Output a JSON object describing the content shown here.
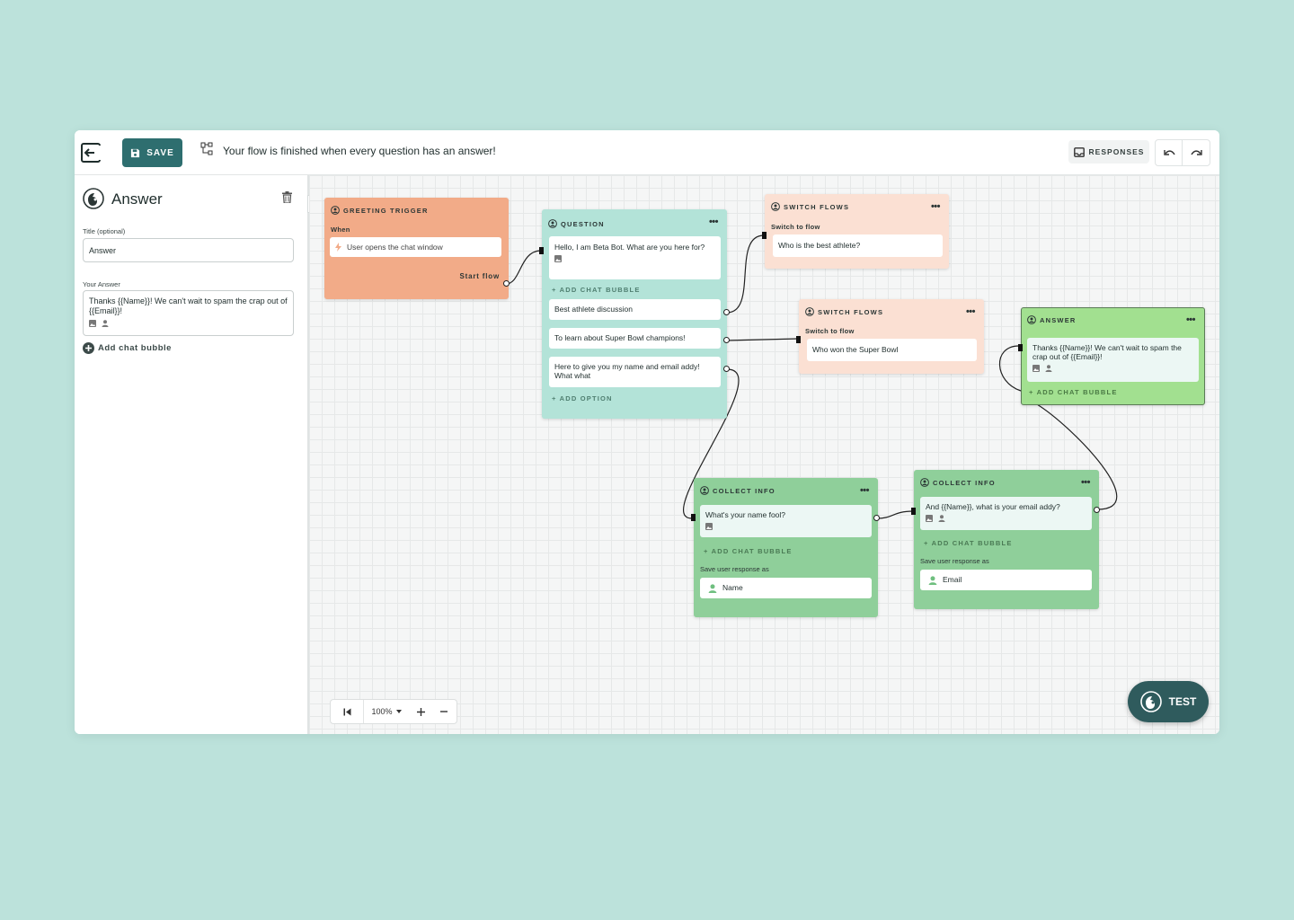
{
  "header": {
    "save_label": "SAVE",
    "status_text": "Your flow is finished when every question has an answer!",
    "responses_label": "RESPONSES"
  },
  "sidebar": {
    "title": "Answer",
    "title_field_label": "Title (optional)",
    "title_field_value": "Answer",
    "answer_field_label": "Your Answer",
    "answer_field_value": "Thanks {{Name}}! We can't wait to spam the crap out of {{Email}}!",
    "add_bubble_label": "Add chat bubble"
  },
  "nodes": {
    "greeting": {
      "header": "GREETING TRIGGER",
      "when_label": "When",
      "trigger_text": "User opens the chat window",
      "start_label": "Start flow",
      "color": "#f2ab88"
    },
    "question": {
      "header": "QUESTION",
      "menu": "•••",
      "message": "Hello, I am Beta Bot. What are you here for?",
      "add_bubble": "+ ADD CHAT BUBBLE",
      "options": [
        "Best athlete discussion",
        "To learn about Super Bowl champions!",
        "Here to give you my name and email addy! What what"
      ],
      "add_option": "+ ADD OPTION",
      "color": "#b3e3d8"
    },
    "switch1": {
      "header": "SWITCH FLOWS",
      "menu": "•••",
      "sub": "Switch to flow",
      "flow": "Who is the best athlete?",
      "color": "#fbe0d3"
    },
    "switch2": {
      "header": "SWITCH FLOWS",
      "menu": "•••",
      "sub": "Switch to flow",
      "flow": "Who won the Super Bowl",
      "color": "#fbe0d3"
    },
    "answer": {
      "header": "ANSWER",
      "menu": "•••",
      "message": "Thanks {{Name}}! We can't wait to spam the crap out of {{Email}}!",
      "add_bubble": "+ ADD CHAT BUBBLE",
      "color": "#a2e090"
    },
    "collect1": {
      "header": "COLLECT INFO",
      "menu": "•••",
      "message": "What's your name fool?",
      "add_bubble": "+ ADD CHAT BUBBLE",
      "save_label": "Save user response as",
      "field": "Name",
      "color": "#8fcf9a"
    },
    "collect2": {
      "header": "COLLECT INFO",
      "menu": "•••",
      "message": "And {{Name}}, what is your email addy?",
      "add_bubble": "+ ADD CHAT BUBBLE",
      "save_label": "Save user response as",
      "field": "Email",
      "color": "#8fcf9a"
    }
  },
  "zoom": {
    "level": "100%"
  },
  "test_label": "TEST",
  "icons": [
    "exit-icon",
    "save-icon",
    "flow-icon",
    "inbox-icon",
    "undo-icon",
    "redo-icon",
    "bot-logo-icon",
    "trash-icon",
    "plus-circle-icon",
    "image-icon",
    "user-icon",
    "lightning-icon",
    "chevron-left-icon",
    "skip-start-icon",
    "caret-down-icon",
    "plus-icon",
    "minus-icon"
  ]
}
